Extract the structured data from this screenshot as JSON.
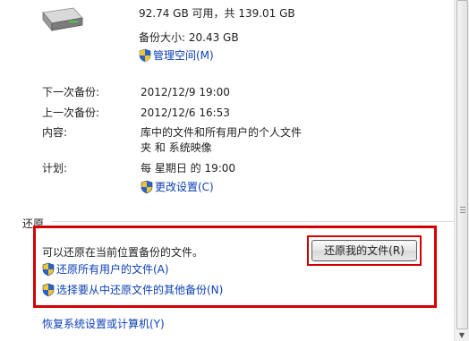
{
  "drive": {
    "icon": "hard-drive-icon",
    "space": "92.74 GB 可用，共 139.01 GB"
  },
  "backup": {
    "size_text": "备份大小: 20.43 GB",
    "manage_space_link": "管理空间(M)",
    "next_label": "下一次备份:",
    "next_value": "2012/12/9 19:00",
    "last_label": "上一次备份:",
    "last_value": "2012/12/6 16:53",
    "contents_label": "内容:",
    "contents_line1": "库中的文件和所有用户的个人文件",
    "contents_line2": "夹 和 系统映像",
    "schedule_label": "计划:",
    "schedule_value": "每 星期日 的 19:00",
    "change_settings_link": "更改设置(C)"
  },
  "restore": {
    "heading": "还原",
    "description": "可以还原在当前位置备份的文件。",
    "restore_button": "还原我的文件(R)",
    "restore_all_users_link": "还原所有用户的文件(A)",
    "select_other_backup_link": "选择要从中还原文件的其他备份(N)"
  },
  "recover_link": "恢复系统设置或计算机(Y)",
  "colors": {
    "link": "#0a3fb8",
    "highlight": "#d40000"
  }
}
